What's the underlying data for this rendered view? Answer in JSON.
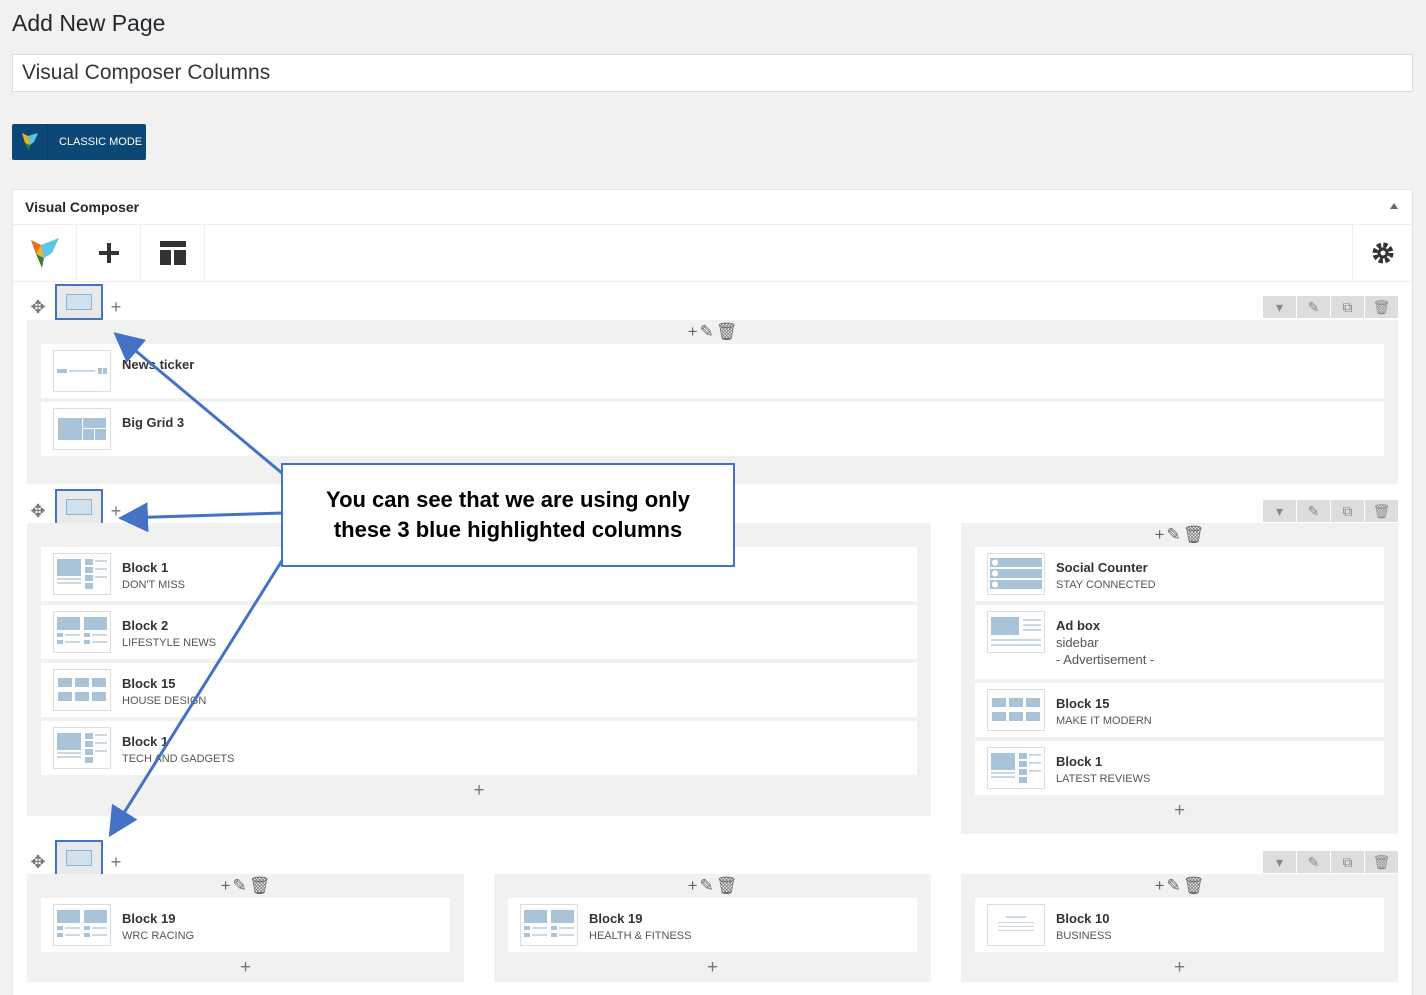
{
  "page": {
    "heading": "Add New Page",
    "title_value": "Visual Composer Columns"
  },
  "classic_mode": {
    "label": "CLASSIC MODE"
  },
  "panel": {
    "title": "Visual Composer"
  },
  "callout": {
    "line1": "You can see that we are using only",
    "line2": "these 3 blue highlighted columns"
  },
  "row1": {
    "columns": [
      {
        "elements": [
          {
            "title": "News ticker",
            "subtitle": ""
          },
          {
            "title": "Big Grid 3",
            "subtitle": ""
          }
        ]
      }
    ]
  },
  "row2": {
    "columns": [
      {
        "elements": [
          {
            "title": "Block 1",
            "subtitle": "DON'T MISS"
          },
          {
            "title": "Block 2",
            "subtitle": "LIFESTYLE NEWS"
          },
          {
            "title": "Block 15",
            "subtitle": "HOUSE DESIGN"
          },
          {
            "title": "Block 1",
            "subtitle": "TECH AND GADGETS"
          }
        ]
      },
      {
        "elements": [
          {
            "title": "Social Counter",
            "subtitle": "STAY CONNECTED"
          },
          {
            "title": "Ad box",
            "subtitle": "sidebar",
            "subtitle2": "- Advertisement -"
          },
          {
            "title": "Block 15",
            "subtitle": "MAKE IT MODERN"
          },
          {
            "title": "Block 1",
            "subtitle": "LATEST REVIEWS"
          }
        ]
      }
    ]
  },
  "row3": {
    "columns": [
      {
        "elements": [
          {
            "title": "Block 19",
            "subtitle": "WRC RACING"
          }
        ]
      },
      {
        "elements": [
          {
            "title": "Block 19",
            "subtitle": "HEALTH & FITNESS"
          }
        ]
      },
      {
        "elements": [
          {
            "title": "Block 10",
            "subtitle": "BUSINESS"
          }
        ]
      }
    ]
  },
  "colors": {
    "accent": "#0b4876",
    "highlight": "#4472c4"
  }
}
